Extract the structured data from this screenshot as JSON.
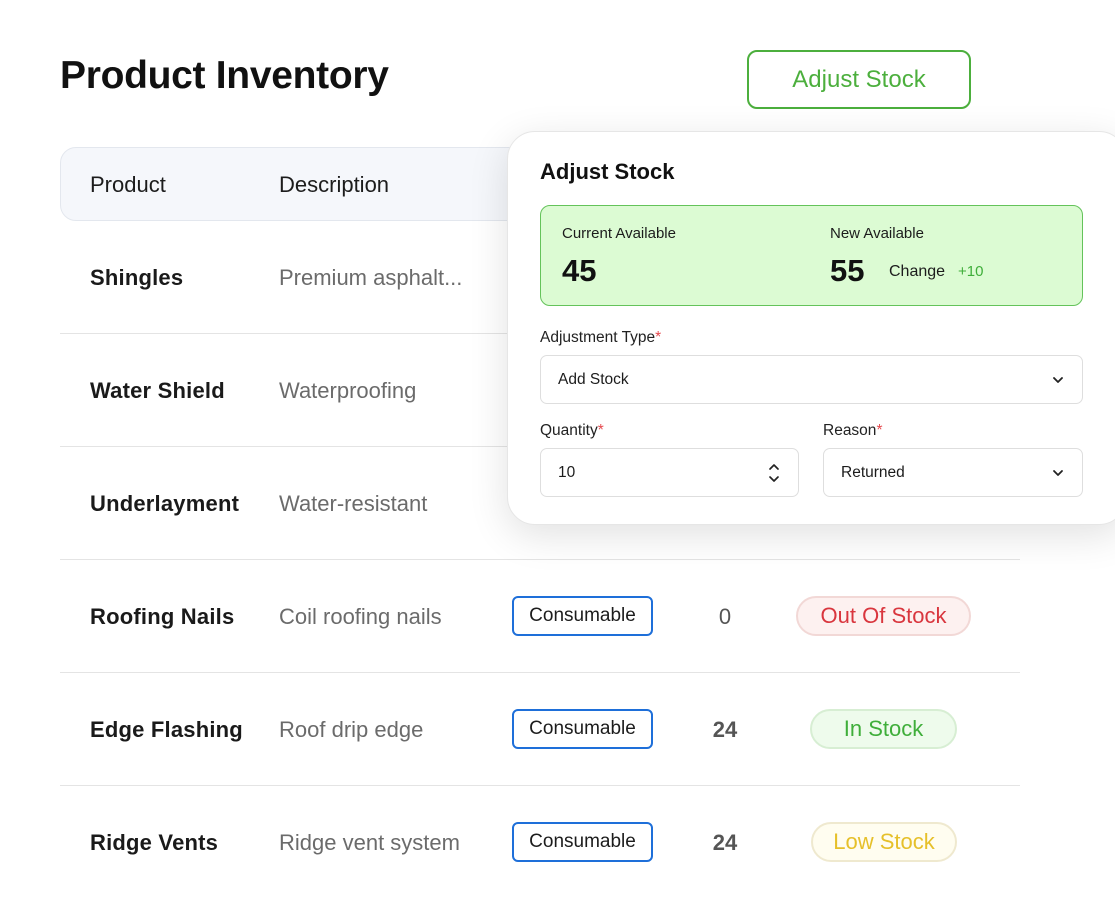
{
  "page": {
    "title": "Product Inventory",
    "adjust_button_label": "Adjust Stock"
  },
  "table": {
    "columns": [
      "Product",
      "Description"
    ],
    "rows": [
      {
        "name": "Shingles",
        "description": "Premium asphalt..."
      },
      {
        "name": "Water Shield",
        "description": "Waterproofing"
      },
      {
        "name": "Underlayment",
        "description": "Water-resistant"
      },
      {
        "name": "Roofing Nails",
        "description": "Coil roofing nails",
        "category": "Consumable",
        "quantity": "0",
        "status": "Out Of Stock"
      },
      {
        "name": "Edge Flashing",
        "description": "Roof drip edge",
        "category": "Consumable",
        "quantity": "24",
        "status": "In Stock"
      },
      {
        "name": "Ridge Vents",
        "description": "Ridge vent system",
        "category": "Consumable",
        "quantity": "24",
        "status": "Low Stock"
      }
    ]
  },
  "modal": {
    "title": "Adjust Stock",
    "current_label": "Current Available",
    "current_value": "45",
    "new_label": "New Available",
    "new_value": "55",
    "change_label": "Change",
    "change_value": "+10",
    "adjustment_type_label": "Adjustment Type",
    "adjustment_type_value": "Add Stock",
    "quantity_label": "Quantity",
    "quantity_value": "10",
    "reason_label": "Reason",
    "reason_value": "Returned",
    "required_mark": "*"
  },
  "colors": {
    "accent_green": "#4caf3d",
    "category_border": "#1e6fd9",
    "out_of_stock": "#d9363e",
    "in_stock": "#3fae3a",
    "low_stock": "#e6c02a"
  },
  "icons": {
    "dropdown": "chevron-down-icon",
    "stepper": "chevron-up-down-icon"
  }
}
